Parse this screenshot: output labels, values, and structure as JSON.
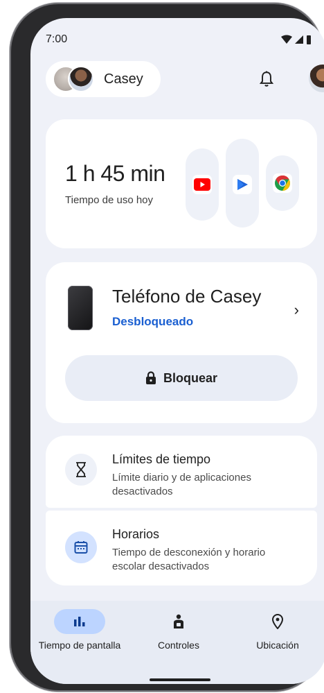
{
  "status_bar": {
    "time": "7:00"
  },
  "header": {
    "child_name": "Casey"
  },
  "usage": {
    "time_value": "1 h 45 min",
    "time_label": "Tiempo de uso hoy",
    "apps": [
      "youtube-icon",
      "play-movies-icon",
      "chrome-icon"
    ]
  },
  "device": {
    "name": "Teléfono de Casey",
    "status": "Desbloqueado",
    "lock_label": "Bloquear"
  },
  "limits": {
    "title": "Límites de tiempo",
    "subtitle": "Límite diario y de aplicaciones desactivados"
  },
  "schedules": {
    "title": "Horarios",
    "subtitle": "Tiempo de desconexión y horario escolar desactivados"
  },
  "bottom_nav": {
    "items": [
      {
        "label": "Tiempo de pantalla",
        "icon": "bar-chart-icon",
        "active": true
      },
      {
        "label": "Controles",
        "icon": "controls-icon",
        "active": false
      },
      {
        "label": "Ubicación",
        "icon": "location-pin-icon",
        "active": false
      }
    ]
  },
  "colors": {
    "accent": "#1a5fd1",
    "background": "#eff1f8",
    "nav_active": "#bcd4ff"
  }
}
